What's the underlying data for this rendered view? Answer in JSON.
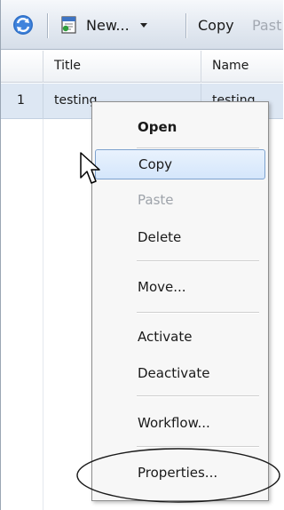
{
  "toolbar": {
    "refresh_icon": "refresh-icon",
    "new_label": "New...",
    "new_icon": "new-document-icon",
    "copy_label": "Copy",
    "paste_label": "Past"
  },
  "grid": {
    "headers": {
      "rownum": "",
      "title": "Title",
      "name": "Name"
    },
    "rows": [
      {
        "num": "1",
        "title": "testing",
        "name": "testing"
      }
    ]
  },
  "context_menu": {
    "items": [
      {
        "label": "Open",
        "style": "bold"
      },
      {
        "label": "Copy",
        "style": "highlighted"
      },
      {
        "label": "Paste",
        "style": "disabled"
      },
      {
        "label": "Delete",
        "style": "normal"
      },
      {
        "label": "Move...",
        "style": "normal"
      },
      {
        "label": "Activate",
        "style": "normal"
      },
      {
        "label": "Deactivate",
        "style": "normal"
      },
      {
        "label": "Workflow...",
        "style": "normal"
      },
      {
        "label": "Properties...",
        "style": "normal"
      }
    ]
  },
  "annotation": {
    "shape": "ellipse",
    "target": "Properties..."
  },
  "colors": {
    "toolbar_top": "#f6f8fb",
    "toolbar_bottom": "#d6dee9",
    "selected_row": "#dde7f3",
    "menu_bg": "#f7f7f7",
    "menu_highlight": "#d4e6fb",
    "menu_highlight_border": "#7da2ce",
    "disabled_text": "#9ea3aa"
  }
}
